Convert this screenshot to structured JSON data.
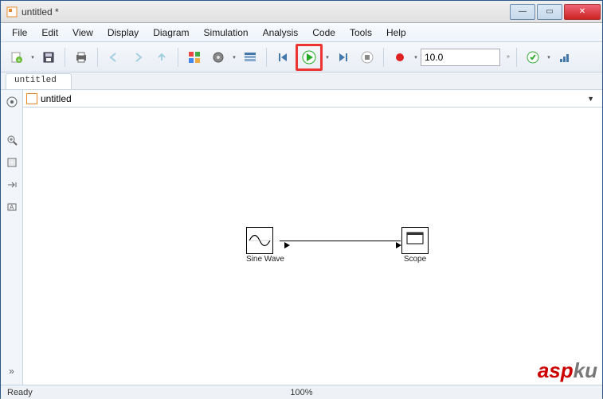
{
  "title": "untitled *",
  "menu": {
    "file": "File",
    "edit": "Edit",
    "view": "View",
    "display": "Display",
    "diagram": "Diagram",
    "simulation": "Simulation",
    "analysis": "Analysis",
    "code": "Code",
    "tools": "Tools",
    "help": "Help"
  },
  "toolbar": {
    "simtime": "10.0"
  },
  "tabs": [
    {
      "label": "untitled"
    }
  ],
  "breadcrumb": {
    "model": "untitled"
  },
  "blocks": {
    "sine": {
      "label": "Sine Wave"
    },
    "scope": {
      "label": "Scope"
    }
  },
  "status": {
    "left": "Ready",
    "center": "100%"
  },
  "watermark": {
    "a": "asp",
    "b": "ku"
  }
}
